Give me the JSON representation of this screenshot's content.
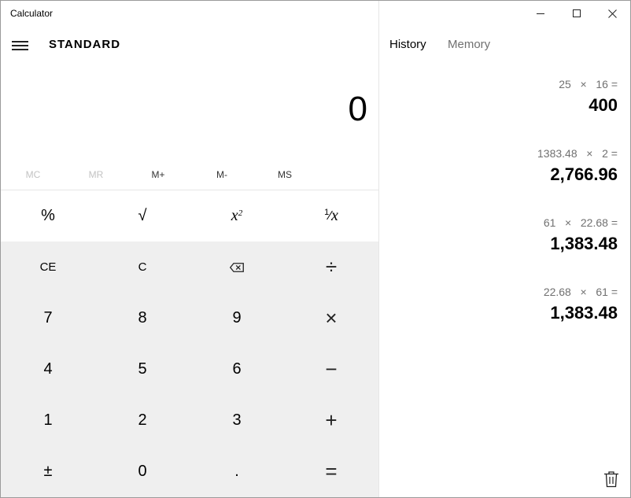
{
  "window": {
    "title": "Calculator",
    "minimize_icon": "minimize-icon",
    "maximize_icon": "maximize-icon",
    "close_icon": "close-icon"
  },
  "header": {
    "menu_icon": "hamburger-menu-icon",
    "mode": "STANDARD"
  },
  "display": {
    "value": "0"
  },
  "memory": {
    "buttons": [
      {
        "label": "MC",
        "enabled": false
      },
      {
        "label": "MR",
        "enabled": false
      },
      {
        "label": "M+",
        "enabled": true
      },
      {
        "label": "M-",
        "enabled": true
      },
      {
        "label": "MS",
        "enabled": true
      }
    ]
  },
  "keypad": {
    "percent": "%",
    "sqrt": "√",
    "square_base": "x",
    "square_exp": "2",
    "reciprocal_num": "1",
    "reciprocal_den": "x",
    "ce": "CE",
    "c": "C",
    "backspace_icon": "backspace-icon",
    "divide": "÷",
    "seven": "7",
    "eight": "8",
    "nine": "9",
    "multiply": "×",
    "four": "4",
    "five": "5",
    "six": "6",
    "minus": "−",
    "one": "1",
    "two": "2",
    "three": "3",
    "plus": "+",
    "negate": "±",
    "zero": "0",
    "decimal": ".",
    "equals": "="
  },
  "tabs": {
    "history": "History",
    "memory": "Memory"
  },
  "history": [
    {
      "expression": "25   ×   16 =",
      "result": "400"
    },
    {
      "expression": "1383.48   ×   2 =",
      "result": "2,766.96"
    },
    {
      "expression": "61   ×   22.68 =",
      "result": "1,383.48"
    },
    {
      "expression": "22.68   ×   61 =",
      "result": "1,383.48"
    }
  ],
  "footer": {
    "trash_icon": "trash-icon"
  }
}
